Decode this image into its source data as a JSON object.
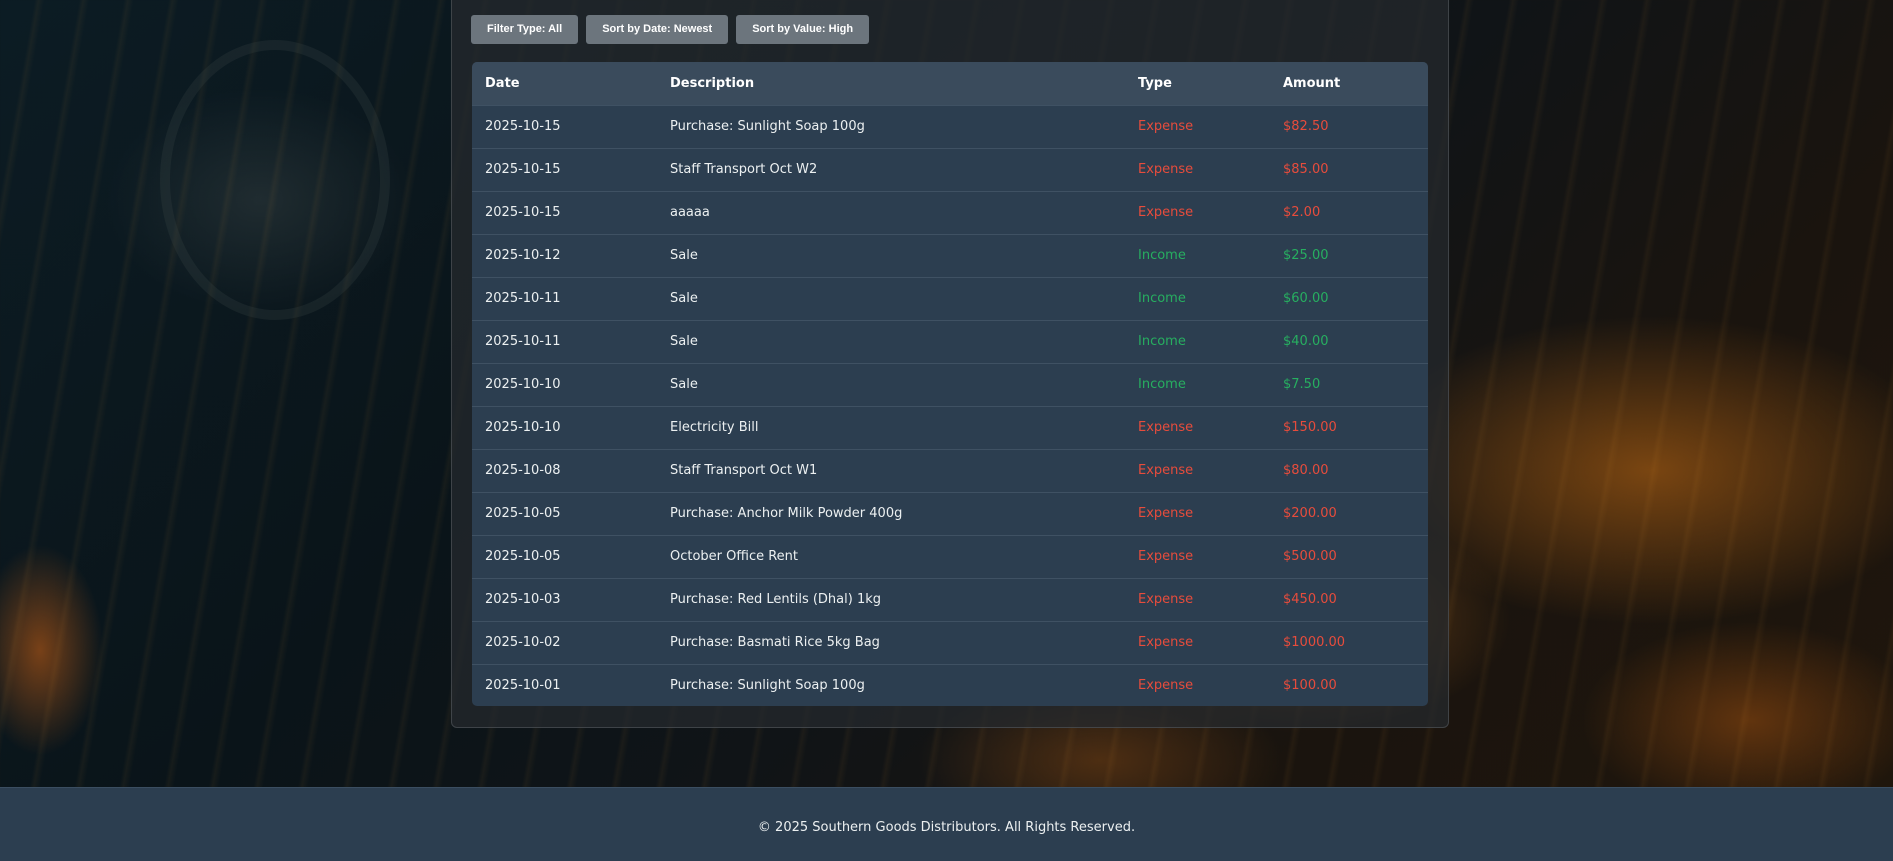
{
  "toolbar": {
    "filter_label": "Filter Type: All",
    "sort_date_label": "Sort by Date: Newest",
    "sort_value_label": "Sort by Value: High"
  },
  "table": {
    "headers": [
      "Date",
      "Description",
      "Type",
      "Amount"
    ],
    "rows": [
      {
        "date": "2025-10-15",
        "description": "Purchase: Sunlight Soap 100g",
        "type": "Expense",
        "amount": "$82.50"
      },
      {
        "date": "2025-10-15",
        "description": "Staff Transport Oct W2",
        "type": "Expense",
        "amount": "$85.00"
      },
      {
        "date": "2025-10-15",
        "description": "aaaaa",
        "type": "Expense",
        "amount": "$2.00"
      },
      {
        "date": "2025-10-12",
        "description": "Sale",
        "type": "Income",
        "amount": "$25.00"
      },
      {
        "date": "2025-10-11",
        "description": "Sale",
        "type": "Income",
        "amount": "$60.00"
      },
      {
        "date": "2025-10-11",
        "description": "Sale",
        "type": "Income",
        "amount": "$40.00"
      },
      {
        "date": "2025-10-10",
        "description": "Sale",
        "type": "Income",
        "amount": "$7.50"
      },
      {
        "date": "2025-10-10",
        "description": "Electricity Bill",
        "type": "Expense",
        "amount": "$150.00"
      },
      {
        "date": "2025-10-08",
        "description": "Staff Transport Oct W1",
        "type": "Expense",
        "amount": "$80.00"
      },
      {
        "date": "2025-10-05",
        "description": "Purchase: Anchor Milk Powder 400g",
        "type": "Expense",
        "amount": "$200.00"
      },
      {
        "date": "2025-10-05",
        "description": "October Office Rent",
        "type": "Expense",
        "amount": "$500.00"
      },
      {
        "date": "2025-10-03",
        "description": "Purchase: Red Lentils (Dhal) 1kg",
        "type": "Expense",
        "amount": "$450.00"
      },
      {
        "date": "2025-10-02",
        "description": "Purchase: Basmati Rice 5kg Bag",
        "type": "Expense",
        "amount": "$1000.00"
      },
      {
        "date": "2025-10-01",
        "description": "Purchase: Sunlight Soap 100g",
        "type": "Expense",
        "amount": "$100.00"
      }
    ]
  },
  "colors": {
    "expense": "#e74c3c",
    "income": "#27ae60",
    "button": "#6c757d",
    "table_bg": "#2c3e50",
    "header_bg": "#3a4b5c"
  },
  "footer": {
    "copyright": "© 2025 Southern Goods Distributors. All Rights Reserved."
  }
}
